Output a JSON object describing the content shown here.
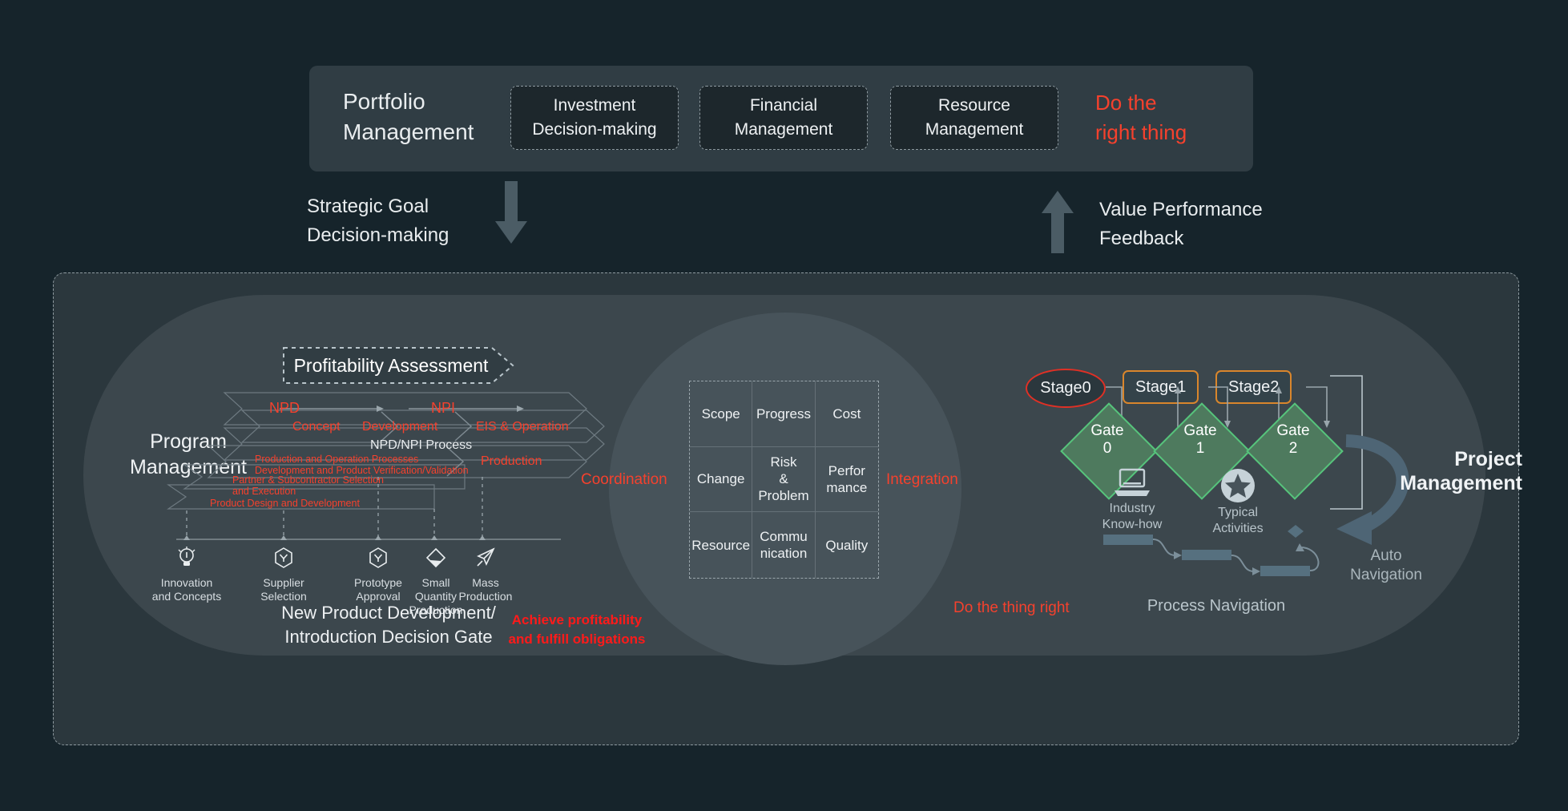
{
  "colors": {
    "page_bg": "#16242b",
    "panel_bg": "#2b373d",
    "bar_bg": "#303d44",
    "accent_red": "#f5412d",
    "bright_red": "#ff1a1a",
    "gate_green": "#56c47c",
    "stage_orange": "#d9862c",
    "stage0_red": "#e03025",
    "text_light": "#e9edef",
    "text_muted": "#b9c5cb"
  },
  "portfolio": {
    "title": "Portfolio\nManagement",
    "title_line1": "Portfolio",
    "title_line2": "Management",
    "cards": [
      {
        "line1": "Investment",
        "line2": "Decision-making"
      },
      {
        "line1": "Financial",
        "line2": "Management"
      },
      {
        "line1": "Resource",
        "line2": "Management"
      }
    ],
    "slogan_line1": "Do the",
    "slogan_line2": "right thing"
  },
  "connectors": {
    "down_line1": "Strategic Goal",
    "down_line2": "Decision-making",
    "down_icon": "arrow-down-icon",
    "up_line1": "Value Performance",
    "up_line2": "Feedback",
    "up_icon": "arrow-up-icon"
  },
  "program": {
    "label_line1": "Program",
    "label_line2": "Management",
    "profitability_chip": "Profitability Assessment",
    "npd_label": "NPD",
    "npi_label": "NPI",
    "phase_band": [
      "Concept",
      "Development",
      "EIS & Operation"
    ],
    "process_band": "NPD/NPI Process",
    "production_band_left_line1": "Production and Operation Processes",
    "production_band_left_line2": "Development and  Product Verification/Validation",
    "production_band_right": "Production",
    "partner_band_line1": "Partner & Subcontractor Selection",
    "partner_band_line2": "and Execution",
    "design_band": "Product Design and Development",
    "gates": [
      {
        "icon": "lightbulb-icon",
        "line1": "Innovation",
        "line2": "and Concepts"
      },
      {
        "icon": "hexagon-y-icon",
        "line1": "Supplier",
        "line2": "Selection"
      },
      {
        "icon": "hexagon-y-icon",
        "line1": "Prototype",
        "line2": "Approval"
      },
      {
        "icon": "flask-icon",
        "line1": "Small",
        "line2": "Quantity",
        "line3": "Production"
      },
      {
        "icon": "paper-plane-icon",
        "line1": "Mass",
        "line2": "Production"
      }
    ],
    "decision_gate_line1": "New Product Development/",
    "decision_gate_line2": "Introduction Decision Gate",
    "achieve_note_line1": "Achieve profitability",
    "achieve_note_line2": "and fulfill obligations"
  },
  "knowledge_grid": {
    "coordination_label": "Coordination",
    "integration_label": "Integration",
    "rows": [
      [
        "Scope",
        "Progress",
        "Cost"
      ],
      [
        "Change",
        "Risk\n&\nProblem",
        "Perfor\nmance"
      ],
      [
        "Resource",
        "Commu\nnication",
        "Quality"
      ]
    ],
    "cells": [
      {
        "text": "Scope"
      },
      {
        "text": "Progress"
      },
      {
        "text": "Cost"
      },
      {
        "text": "Change"
      },
      {
        "text": "Risk & Problem",
        "lines": [
          "Risk",
          "&",
          "Problem"
        ]
      },
      {
        "text": "Performance",
        "lines": [
          "Perfor",
          "mance"
        ]
      },
      {
        "text": "Resource"
      },
      {
        "text": "Communication",
        "lines": [
          "Commu",
          "nication"
        ]
      },
      {
        "text": "Quality"
      }
    ]
  },
  "project": {
    "stages": [
      {
        "label": "Stage0",
        "shape": "ellipse",
        "color": "#e03025"
      },
      {
        "label": "Stage1",
        "shape": "rounded-rect",
        "color": "#d9862c"
      },
      {
        "label": "Stage2",
        "shape": "rounded-rect",
        "color": "#d9862c"
      }
    ],
    "gates": [
      {
        "line1": "Gate",
        "line2": "0"
      },
      {
        "line1": "Gate",
        "line2": "1"
      },
      {
        "line1": "Gate",
        "line2": "2"
      }
    ],
    "icons": [
      {
        "icon": "laptop-icon",
        "line1": "Industry",
        "line2": "Know-how"
      },
      {
        "icon": "star-badge-icon",
        "line1": "Typical",
        "line2": "Activities"
      }
    ],
    "process_navigation_label": "Process Navigation",
    "do_thing_right": "Do the thing right",
    "title_line1": "Project",
    "title_line2": "Management",
    "auto_nav_line1": "Auto",
    "auto_nav_line2": "Navigation"
  }
}
